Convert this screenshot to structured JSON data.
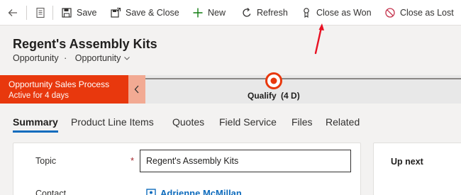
{
  "toolbar": {
    "save_label": "Save",
    "save_close_label": "Save & Close",
    "new_label": "New",
    "refresh_label": "Refresh",
    "close_won_label": "Close as Won",
    "close_lost_label": "Close as Lost"
  },
  "header": {
    "title": "Regent's Assembly Kits",
    "entity": "Opportunity",
    "separator": "·",
    "form_selector": "Opportunity"
  },
  "process": {
    "name": "Opportunity Sales Process",
    "active_for": "Active for 4 days",
    "stage": "Qualify",
    "stage_duration": "(4 D)",
    "accent_color": "#e8380d"
  },
  "tabs": [
    {
      "label": "Summary",
      "active": true
    },
    {
      "label": "Product Line Items",
      "active": false
    },
    {
      "label": "Quotes",
      "active": false
    },
    {
      "label": "Field Service",
      "active": false
    },
    {
      "label": "Files",
      "active": false
    },
    {
      "label": "Related",
      "active": false
    }
  ],
  "form": {
    "topic_label": "Topic",
    "required_marker": "*",
    "topic_value": "Regent's Assembly Kits",
    "contact_label": "Contact",
    "contact_value": "Adrienne McMillan"
  },
  "side": {
    "up_next_label": "Up next"
  },
  "annotation": {
    "arrow_color": "#e81123"
  }
}
